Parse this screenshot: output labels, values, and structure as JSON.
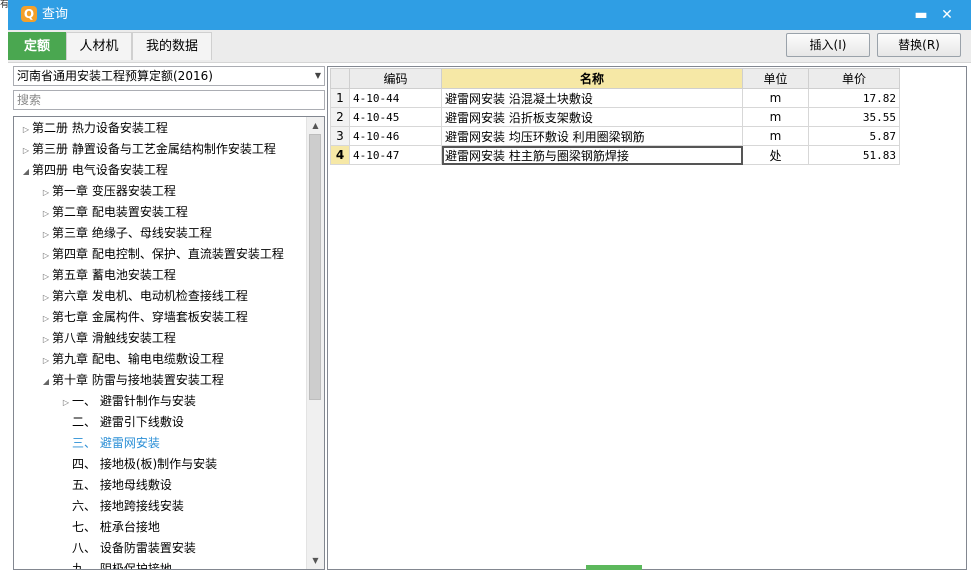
{
  "stray": "有",
  "window": {
    "title": "查询",
    "app_icon": "Q",
    "minimize_glyph": "▬",
    "close_glyph": "✕"
  },
  "tabs": [
    {
      "label": "定额",
      "active": true
    },
    {
      "label": "人材机",
      "active": false
    },
    {
      "label": "我的数据",
      "active": false
    }
  ],
  "toolbar": {
    "insert_label": "插入(I)",
    "replace_label": "替换(R)"
  },
  "left": {
    "library": "河南省通用安装工程预算定额(2016)",
    "search_placeholder": "搜索",
    "tree": [
      {
        "label": "第二册  热力设备安装工程",
        "level": 0,
        "toggle": "▷"
      },
      {
        "label": "第三册  静置设备与工艺金属结构制作安装工程",
        "level": 0,
        "toggle": "▷"
      },
      {
        "label": "第四册  电气设备安装工程",
        "level": 0,
        "toggle": "◢"
      },
      {
        "label": "第一章  变压器安装工程",
        "level": 1,
        "toggle": "▷"
      },
      {
        "label": "第二章  配电装置安装工程",
        "level": 1,
        "toggle": "▷"
      },
      {
        "label": "第三章  绝缘子、母线安装工程",
        "level": 1,
        "toggle": "▷"
      },
      {
        "label": "第四章  配电控制、保护、直流装置安装工程",
        "level": 1,
        "toggle": "▷"
      },
      {
        "label": "第五章  蓄电池安装工程",
        "level": 1,
        "toggle": "▷"
      },
      {
        "label": "第六章  发电机、电动机检查接线工程",
        "level": 1,
        "toggle": "▷"
      },
      {
        "label": "第七章  金属构件、穿墙套板安装工程",
        "level": 1,
        "toggle": "▷"
      },
      {
        "label": "第八章  滑触线安装工程",
        "level": 1,
        "toggle": "▷"
      },
      {
        "label": "第九章  配电、输电电缆敷设工程",
        "level": 1,
        "toggle": "▷"
      },
      {
        "label": "第十章  防雷与接地装置安装工程",
        "level": 1,
        "toggle": "◢"
      },
      {
        "label": "一、  避雷针制作与安装",
        "level": 2,
        "toggle": "▷"
      },
      {
        "label": "二、  避雷引下线敷设",
        "level": 2,
        "toggle": ""
      },
      {
        "label": "三、  避雷网安装",
        "level": 2,
        "toggle": "",
        "selected": true
      },
      {
        "label": "四、  接地极(板)制作与安装",
        "level": 2,
        "toggle": ""
      },
      {
        "label": "五、  接地母线敷设",
        "level": 2,
        "toggle": ""
      },
      {
        "label": "六、  接地跨接线安装",
        "level": 2,
        "toggle": ""
      },
      {
        "label": "七、  桩承台接地",
        "level": 2,
        "toggle": ""
      },
      {
        "label": "八、  设备防雷装置安装",
        "level": 2,
        "toggle": ""
      },
      {
        "label": "九、  阴极保护接地",
        "level": 2,
        "toggle": ""
      }
    ],
    "scroll_up_glyph": "▲",
    "scroll_down_glyph": "▼"
  },
  "grid": {
    "headers": {
      "code": "编码",
      "name": "名称",
      "unit": "单位",
      "price": "单价"
    },
    "rows": [
      {
        "no": "1",
        "code": "4-10-44",
        "name": "避雷网安装 沿混凝土块敷设",
        "unit": "m",
        "price": "17.82"
      },
      {
        "no": "2",
        "code": "4-10-45",
        "name": "避雷网安装 沿折板支架敷设",
        "unit": "m",
        "price": "35.55"
      },
      {
        "no": "3",
        "code": "4-10-46",
        "name": "避雷网安装 均压环敷设 利用圈梁钢筋",
        "unit": "m",
        "price": "5.87"
      },
      {
        "no": "4",
        "code": "4-10-47",
        "name": "避雷网安装 柱主筋与圈梁钢筋焊接",
        "unit": "处",
        "price": "51.83"
      }
    ]
  },
  "colors": {
    "titlebar": "#2f9ee4",
    "active_tab": "#4aa750",
    "header_highlight": "#f6e8a6",
    "selected_tree_text": "#2b8fd6"
  }
}
